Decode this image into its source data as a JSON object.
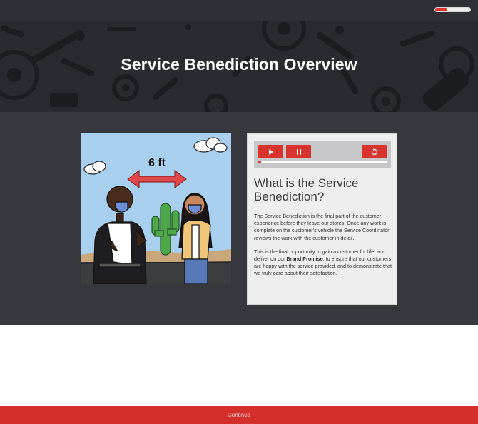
{
  "header": {
    "progress": 0.35,
    "progress_color": "#e0352f"
  },
  "hero": {
    "title": "Service Benediction Overview"
  },
  "illustration": {
    "distance_label": "6 ft"
  },
  "card": {
    "player": {
      "play_icon": "play-icon",
      "pause_icon": "pause-icon",
      "restart_icon": "restart-icon",
      "seek_progress": 0.02
    },
    "heading": "What is the Service Benediction?",
    "paragraph1": "The Service Benediction is the final part of the customer experience before they leave our stores. Once any work is complete on the customer's vehicle the Service Coordinator reviews the work with the customer in detail.",
    "paragraph2_start": "This is the final opportunity to gain a customer for life, and deliver on our ",
    "paragraph2_bold": "Brand Promise",
    "paragraph2_end": ": to ensure that our customers are happy with the service provided, and to demonstrate that we truly care about their satisfaction."
  },
  "footer": {
    "continue_label": "Continue"
  },
  "colors": {
    "accent": "#d8332c",
    "dark_bg": "#37383e",
    "hero_bg": "#2a2b30"
  }
}
